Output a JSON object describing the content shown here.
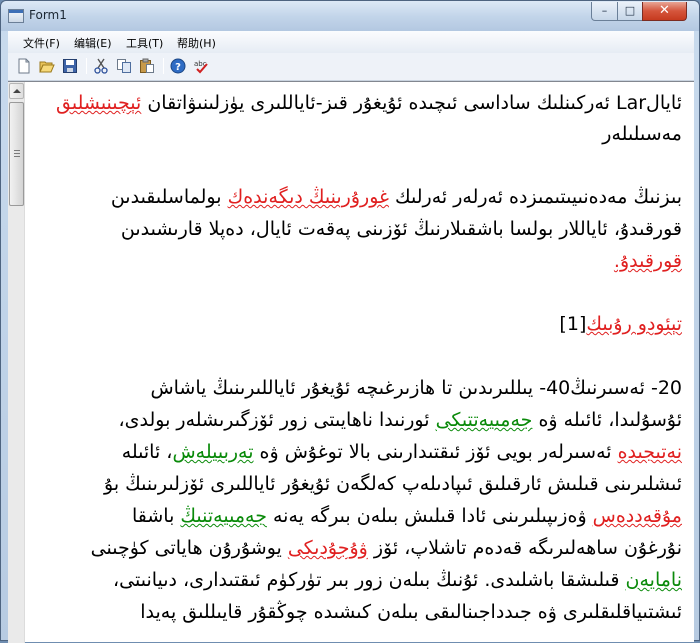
{
  "window": {
    "title": "Form1",
    "minimize_glyph": "–",
    "maximize_glyph": "□",
    "close_glyph": "✕"
  },
  "menu": {
    "items": [
      "文件(F)",
      "编辑(E)",
      "工具(T)",
      "帮助(H)"
    ]
  },
  "toolbar": {
    "icons": [
      "new-document-icon",
      "open-folder-icon",
      "save-disk-icon",
      "cut-scissors-icon",
      "copy-icon",
      "paste-icon",
      "help-icon",
      "spellcheck-icon"
    ]
  },
  "colors": {
    "misspelled": "#e02020",
    "grammar": "#0a8a0a",
    "title_bar": "#c3d5ea",
    "close_button": "#c63a1f"
  },
  "document": {
    "l1a": "ئايالLar ئەركىنلىك ساداسى ئىچىدە ئۇيغۇر قىز-ئاياللىرى يۈزلىنىۋاتقان ",
    "l1b": "ئېچىنىشلىق",
    "l2": "مەسىلىلەر",
    "l3a": "بىزنىڭ مەدەنىيىتىمىزدە ئەرلەر ئەرلىك ",
    "l3b": "غورۇرىنىڭ دىگەندەك",
    "l3c": " بولماسلىقىدىن",
    "l4": "قورقىدۇ، ئاياللار بولسا باشقىلارنىڭ ئۆزىنى پەقەت ئايال، دەپلا قارىشىدىن",
    "l5": "قورقىدۇ.",
    "heading": "تېئودو رۇبىك",
    "ref": "[1]",
    "l6": "20- ئەسىرنىڭ40- يىللىرىدىن تا ھازىرغىچە ئۇيغۇر ئاياللىرىنىڭ ياشاش",
    "l7a": "ئۇسۇلىدا، ئائىلە ۋە ",
    "l7b": "جەمىيەتتىكى",
    "l7c": " ئورنىدا ناھايىتى زور ئۆزگىرىشلەر بولدى،",
    "l8a": "نەتىجىدە",
    "l8b": " ئەسىرلەر بويى ئۆز ئىقتىدارىنى بالا توغۇش ۋە ",
    "l8c": "تەربىيلەش",
    "l8d": "، ئائىلە",
    "l9": "ئىشلىرىنى قىلىش ئارقىلىق ئىپادىلەپ كەلگەن ئۇيغۇر ئاياللىرى ئۆزلىرىنىڭ بۇ",
    "l10a": "مۇقەددەس",
    "l10b": " ۋەزىپىلىرىنى ئادا قىلىش بىلەن بىرگە يەنە ",
    "l10c": "جەمىيەتنىڭ",
    "l10d": " باشقا",
    "l11a": "نۇرغۇن ساھەلىرىگە قەدەم تاشلاپ، ئۆز ",
    "l11b": "ۋۇجۇدىكى",
    "l11c": " يوشۇرۇن ھاياتى كۈچىنى",
    "l12a": "نامايەن",
    "l12b": " قىلىشقا باشلىدى. ئۇنىڭ بىلەن زور بىر تۈركۈم ئىقتىدارى، دىيانىتى،",
    "l13": "ئىشتىياقلىقلىرى ۋە جىدداجىنالىقى بىلەن كىشىدە چوڭقۇر قايىللىق پەيدا"
  }
}
